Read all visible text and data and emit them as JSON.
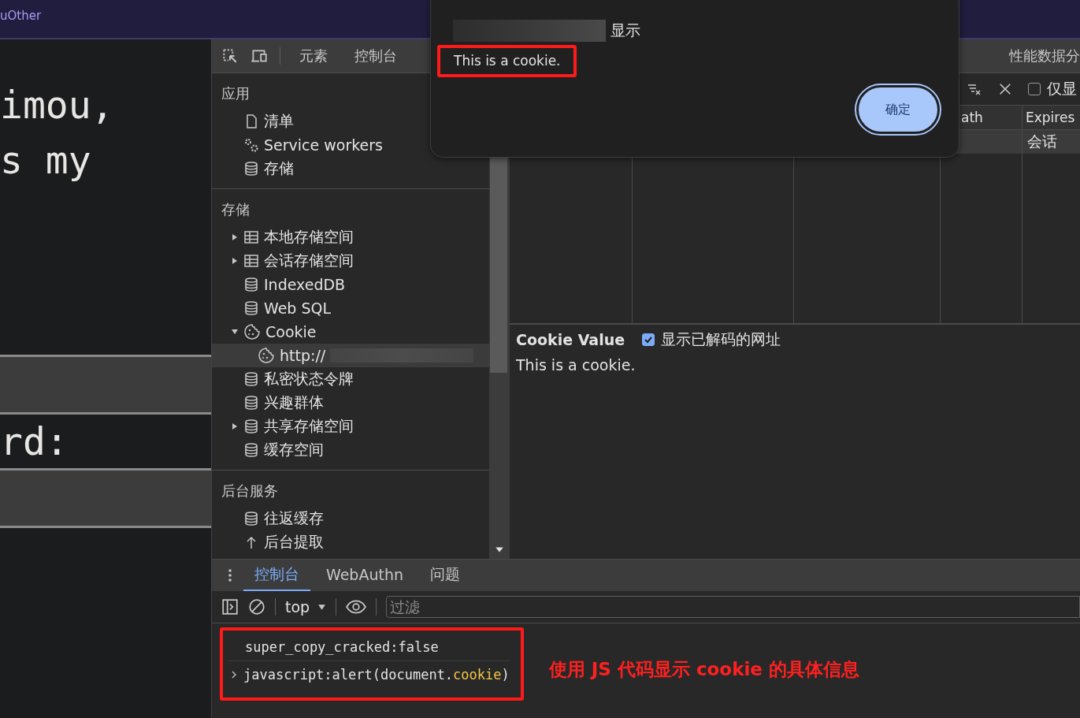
{
  "browser_tab": {
    "title": "uOther"
  },
  "page": {
    "heading_lines": [
      "imou,",
      "s my"
    ],
    "label": "rd:"
  },
  "devtools": {
    "tabs": [
      {
        "label": "元素",
        "selected": false
      },
      {
        "label": "控制台",
        "selected": false
      },
      {
        "label": "性能数据分",
        "selected": false
      }
    ],
    "sidebar": [
      {
        "title": "应用",
        "items": [
          {
            "label": "清单",
            "kind": "file",
            "selected": false
          },
          {
            "label": "Service workers",
            "kind": "gears",
            "selected": false
          },
          {
            "label": "存储",
            "kind": "database",
            "selected": false
          }
        ]
      },
      {
        "title": "存储",
        "items": [
          {
            "label": "本地存储空间",
            "kind": "table",
            "expanded": false,
            "selected": false
          },
          {
            "label": "会话存储空间",
            "kind": "table",
            "expanded": false,
            "selected": false
          },
          {
            "label": "IndexedDB",
            "kind": "database",
            "selected": false
          },
          {
            "label": "Web SQL",
            "kind": "database",
            "selected": false
          },
          {
            "label": "Cookie",
            "kind": "cookie",
            "expanded": true,
            "selected": false,
            "children": [
              {
                "label": "http://",
                "kind": "cookie",
                "selected": true,
                "redacted": true
              }
            ]
          },
          {
            "label": "私密状态令牌",
            "kind": "database",
            "selected": false
          },
          {
            "label": "兴趣群体",
            "kind": "database",
            "selected": false
          },
          {
            "label": "共享存储空间",
            "kind": "database",
            "expanded": false,
            "selected": false
          },
          {
            "label": "缓存空间",
            "kind": "database",
            "selected": false
          }
        ]
      },
      {
        "title": "后台服务",
        "items": [
          {
            "label": "往返缓存",
            "kind": "database",
            "selected": false
          },
          {
            "label": "后台提取",
            "kind": "upload",
            "selected": false
          }
        ]
      }
    ],
    "cookie_toolbar": {
      "only_show": {
        "label": "仅显",
        "checked": false
      }
    },
    "cookie_table": {
      "columns": [
        {
          "label": "ath"
        },
        {
          "label": "Expires"
        }
      ],
      "rows": [
        {
          "expires": "会话",
          "selected": true
        }
      ]
    },
    "cookie_value": {
      "title": "Cookie Value",
      "decode_checkbox": {
        "label": "显示已解码的网址",
        "checked": true
      },
      "value": "This is a cookie."
    },
    "drawer": {
      "tabs": [
        {
          "label": "控制台",
          "selected": true
        },
        {
          "label": "WebAuthn",
          "selected": false
        },
        {
          "label": "问题",
          "selected": false
        }
      ],
      "context": "top",
      "filter": {
        "placeholder": "过滤"
      },
      "lines": [
        {
          "kind": "log",
          "parts": [
            {
              "text": "super_copy_cracked:false",
              "color": "#e3e3e3"
            }
          ]
        },
        {
          "kind": "input",
          "parts": [
            {
              "text": "javascript:alert(document.",
              "color": "#e3e3e3"
            },
            {
              "text": "cookie",
              "color": "#f2c744"
            },
            {
              "text": ")",
              "color": "#e3e3e3"
            }
          ]
        }
      ],
      "annotation": "使用 JS 代码显示 cookie 的具体信息"
    }
  },
  "dialog": {
    "title": "显示",
    "title_redacted": true,
    "message": "This is a cookie.",
    "button": "确定"
  }
}
